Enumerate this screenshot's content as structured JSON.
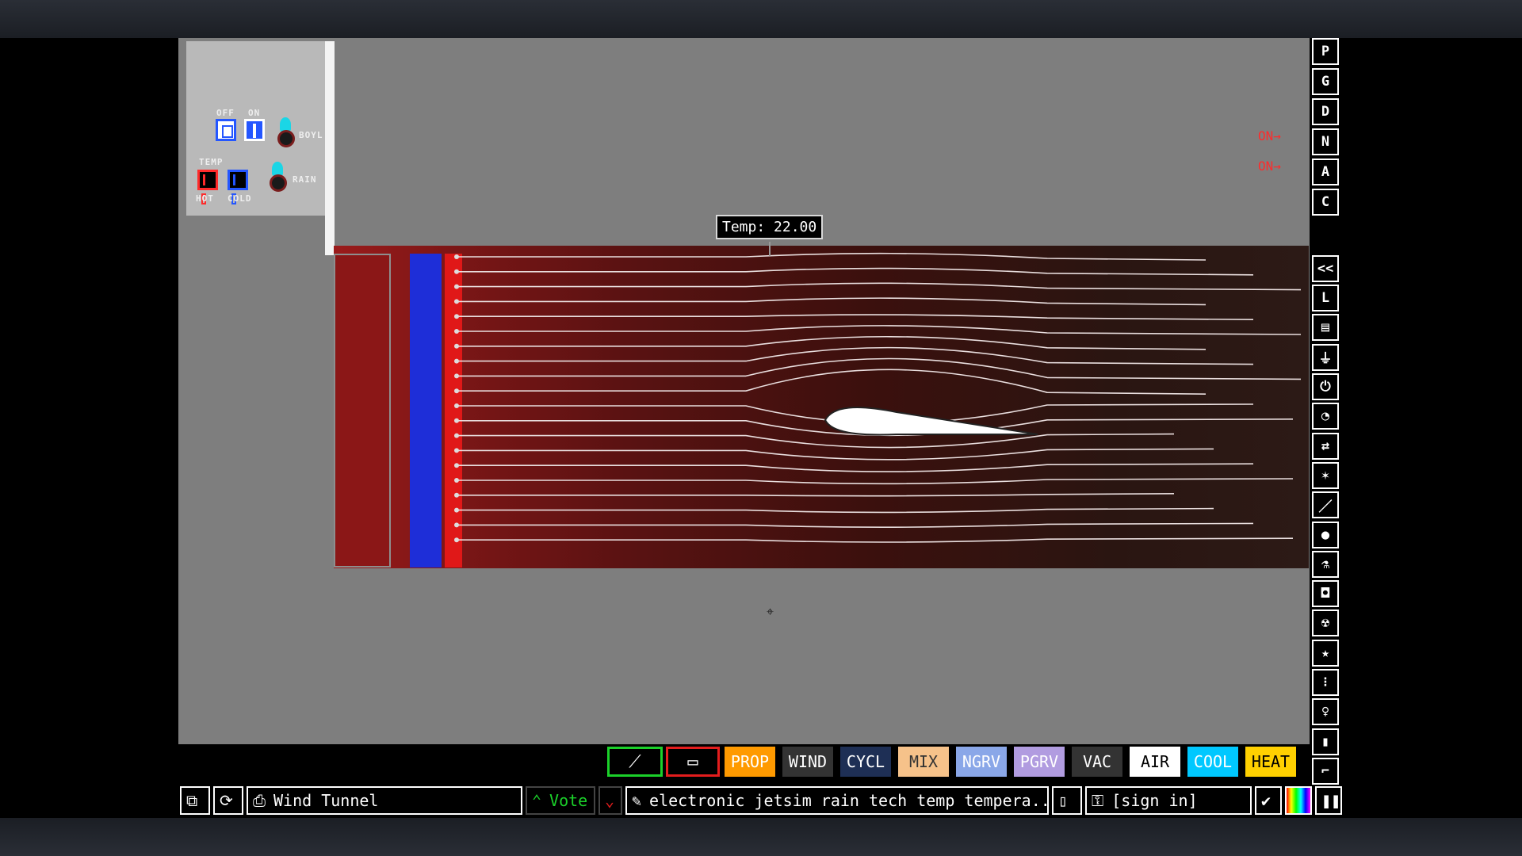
{
  "controls": {
    "off_label": "OFF",
    "on_label": "ON",
    "boyl_label": "BOYL",
    "temp_label": "TEMP",
    "rain_label": "RAIN",
    "hot_label": "HOT",
    "cold_label": "COLD"
  },
  "tooltip": {
    "text": "Temp: 22.00"
  },
  "on_indicators": [
    "ON→",
    "ON→"
  ],
  "sidebar": [
    "P",
    "G",
    "D",
    "N",
    "A",
    "C",
    "<<",
    "L",
    "▤",
    "⏚",
    "⏻",
    "◔",
    "⇄",
    "✶",
    "／",
    "●",
    "⚗",
    "◘",
    "☢",
    "★",
    "⁝",
    "♀",
    "▮",
    "⌐",
    "⌕"
  ],
  "sidebar_icons": [
    "letter-p",
    "letter-g",
    "letter-d",
    "letter-n",
    "letter-a",
    "letter-c",
    "collapse-icon",
    "life-icon",
    "keyboard-icon",
    "plug-icon",
    "power-icon",
    "gauge-icon",
    "arrows-icon",
    "powder-icon",
    "stick-icon",
    "drop-icon",
    "flask-icon",
    "square-icon",
    "radiation-icon",
    "star-icon",
    "dots-icon",
    "lightbulb-icon",
    "bookmark-icon",
    "hammer-icon",
    "magnifier-icon"
  ],
  "toolbar": {
    "items": [
      {
        "label": "PROP",
        "bg": "#ff9a00",
        "fg": "#ffffff"
      },
      {
        "label": "WIND",
        "bg": "#333333",
        "fg": "#ffffff"
      },
      {
        "label": "CYCL",
        "bg": "#1e2f55",
        "fg": "#ffffff"
      },
      {
        "label": "MIX",
        "bg": "#f6c28a",
        "fg": "#333333"
      },
      {
        "label": "NGRV",
        "bg": "#8aa7e8",
        "fg": "#ffffff"
      },
      {
        "label": "PGRV",
        "bg": "#b19ce0",
        "fg": "#ffffff"
      },
      {
        "label": "VAC",
        "bg": "#333333",
        "fg": "#ffffff"
      },
      {
        "label": "AIR",
        "bg": "#ffffff",
        "fg": "#000000"
      },
      {
        "label": "COOL",
        "bg": "#00c8ff",
        "fg": "#ffffff"
      },
      {
        "label": "HEAT",
        "bg": "#ffd000",
        "fg": "#000000"
      }
    ]
  },
  "statusbar": {
    "save_name": "Wind Tunnel",
    "vote_label": "Vote",
    "tags": "electronic jetsim rain tech temp tempera...",
    "signin": "[sign in]"
  }
}
